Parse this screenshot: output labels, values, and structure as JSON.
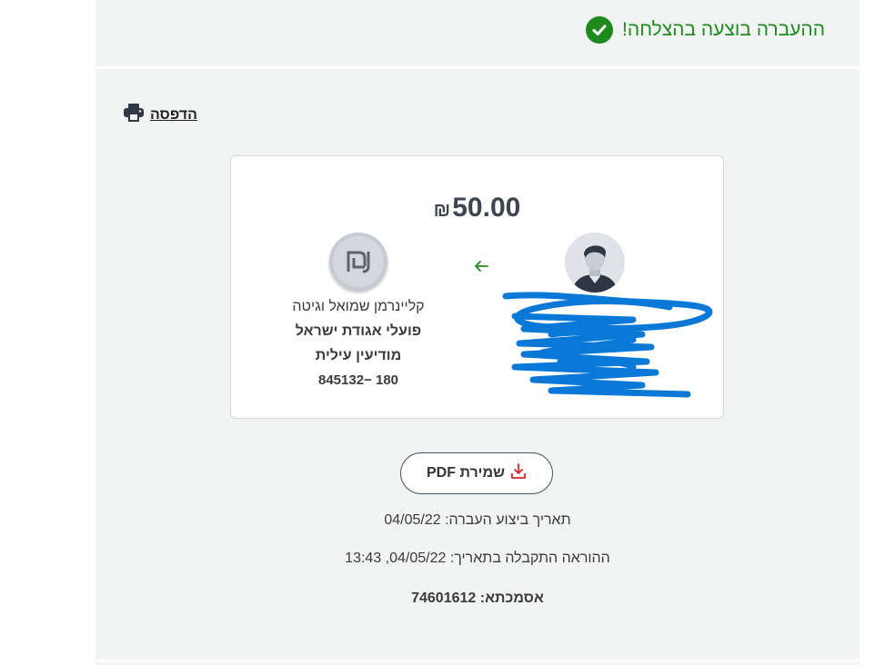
{
  "header": {
    "success_message": "ההעברה בוצעה בהצלחה!",
    "success_icon": "check-circle-icon"
  },
  "print": {
    "label": "הדפסה",
    "icon": "printer-icon"
  },
  "transfer": {
    "amount": "50.00",
    "currency_symbol": "₪",
    "recipient": {
      "name": "קליינרמן שמואל וגיטה",
      "bank": "פועלי אגודת ישראל",
      "branch": "מודיעין עילית",
      "account": "180 −845132"
    }
  },
  "actions": {
    "pdf_label": "שמירת PDF",
    "pdf_icon": "download-icon"
  },
  "details": {
    "execution_date_label": "תאריך ביצוע העברה:",
    "execution_date": "04/05/22",
    "received_label": "ההוראה התקבלה בתאריך:",
    "received_value": "13:43 ,04/05/22",
    "reference_label": "אסמכתא:",
    "reference_value": "74601612"
  },
  "colors": {
    "success": "#1e8a1e",
    "scribble": "#0a78d7",
    "pdf_icon": "#d9242b"
  }
}
